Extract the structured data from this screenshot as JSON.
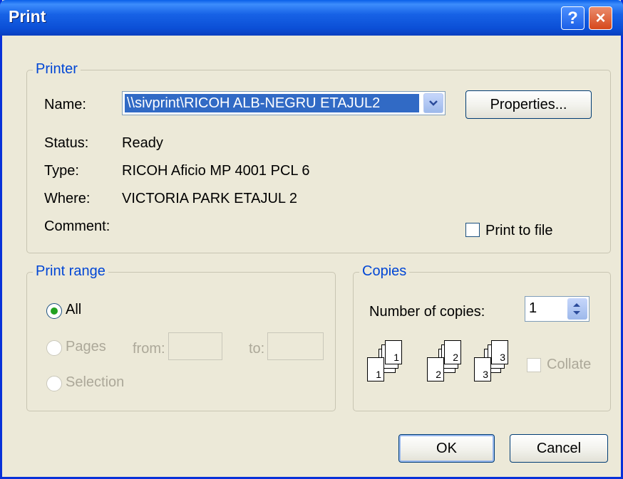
{
  "dialog": {
    "title": "Print"
  },
  "titlebar": {
    "help_label": "?",
    "close_label": "×"
  },
  "printer": {
    "group_label": "Printer",
    "name_label": "Name:",
    "name_value": "\\\\sivprint\\RICOH ALB-NEGRU ETAJUL2",
    "properties_label": "Properties...",
    "status_label": "Status:",
    "status_value": "Ready",
    "type_label": "Type:",
    "type_value": "RICOH Aficio MP 4001 PCL 6",
    "where_label": "Where:",
    "where_value": "VICTORIA PARK ETAJUL 2",
    "comment_label": "Comment:",
    "print_to_file_label": "Print to file",
    "print_to_file_checked": false
  },
  "print_range": {
    "group_label": "Print range",
    "all_label": "All",
    "pages_label": "Pages",
    "from_label": "from:",
    "to_label": "to:",
    "selection_label": "Selection",
    "selected": "All"
  },
  "copies": {
    "group_label": "Copies",
    "number_label": "Number of copies:",
    "number_value": "1",
    "collate_label": "Collate",
    "collate_checked": false,
    "page_numbers": [
      "1",
      "1",
      "2",
      "2",
      "3",
      "3"
    ]
  },
  "actions": {
    "ok_label": "OK",
    "cancel_label": "Cancel"
  },
  "colors": {
    "title_bar": "#0a5fe8",
    "group_label": "#0046d5",
    "selection": "#316ac5",
    "dialog_bg": "#ece9d8"
  }
}
